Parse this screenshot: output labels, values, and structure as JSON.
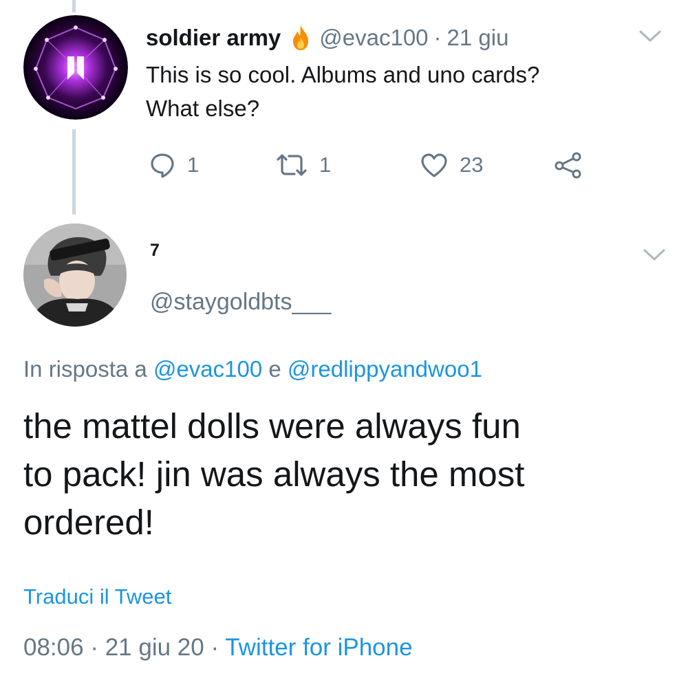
{
  "tweet1": {
    "name": "soldier army",
    "name_emoji": "fire-emoji",
    "handle": "@evac100",
    "separator": "·",
    "date": "21 giu",
    "text_lines": [
      "This is so cool. Albums and uno cards?",
      "What else?"
    ],
    "actions": {
      "reply_count": "1",
      "retweet_count": "1",
      "like_count": "23"
    }
  },
  "tweet2": {
    "name": "7",
    "handle": "@staygoldbts___",
    "reply_prefix": "In risposta a",
    "reply_user1": "@evac100",
    "reply_conj": "e",
    "reply_user2": "@redlippyandwoo1",
    "text_lines": [
      "the mattel dolls were always fun",
      "to pack! jin was always the most",
      "ordered!"
    ],
    "translate_label": "Traduci il Tweet",
    "time": "08:06",
    "separator": "·",
    "date": "21 giu 20",
    "source": "Twitter for iPhone"
  },
  "icons": [
    "chevron-down-icon",
    "reply-icon",
    "retweet-icon",
    "like-icon",
    "share-icon",
    "fire-emoji"
  ],
  "colors": {
    "text_primary": "#14171a",
    "text_secondary": "#657786",
    "link_blue": "#1b95e0",
    "thread_line": "#ccd6dd"
  }
}
